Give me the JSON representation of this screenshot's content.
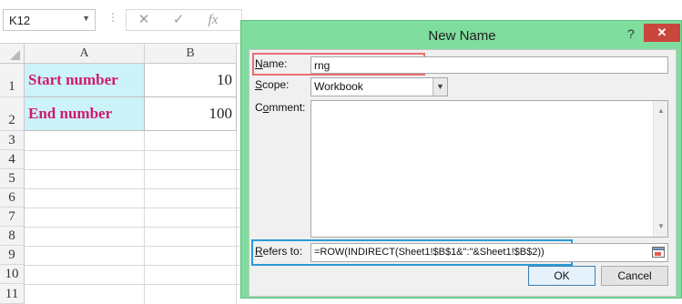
{
  "formula_bar": {
    "name_box_value": "K12",
    "dots": "⋮",
    "cancel_symbol": "✕",
    "enter_symbol": "✓",
    "fx_symbol": "fx",
    "formula": ""
  },
  "sheet": {
    "columns": [
      "A",
      "B"
    ],
    "rows": [
      "1",
      "2",
      "3",
      "4",
      "5",
      "6",
      "7",
      "8",
      "9",
      "10",
      "11"
    ],
    "cells": {
      "a1": "Start number",
      "b1": "10",
      "a2": "End number",
      "b2": "100"
    },
    "label_bg": "#ccf3f7",
    "label_color": "#d21a6c"
  },
  "dialog": {
    "title": "New Name",
    "help": "?",
    "close": "✕",
    "name_label_u": "N",
    "name_label_rest": "ame:",
    "name_value": "rng",
    "scope_label_u": "S",
    "scope_label_rest": "cope:",
    "scope_value": "Workbook",
    "comment_label_pre": "C",
    "comment_label_u": "o",
    "comment_label_rest": "mment:",
    "comment_value": "",
    "refers_label_u": "R",
    "refers_label_rest": "efers to:",
    "refers_value": "=ROW(INDIRECT(Sheet1!$B$1&\":\"&Sheet1!$B$2))",
    "ok_label": "OK",
    "cancel_label": "Cancel",
    "title_bar_color": "#7fdd9e",
    "highlight_name_color": "#e86f6f",
    "highlight_refers_color": "#2b9bd6"
  }
}
